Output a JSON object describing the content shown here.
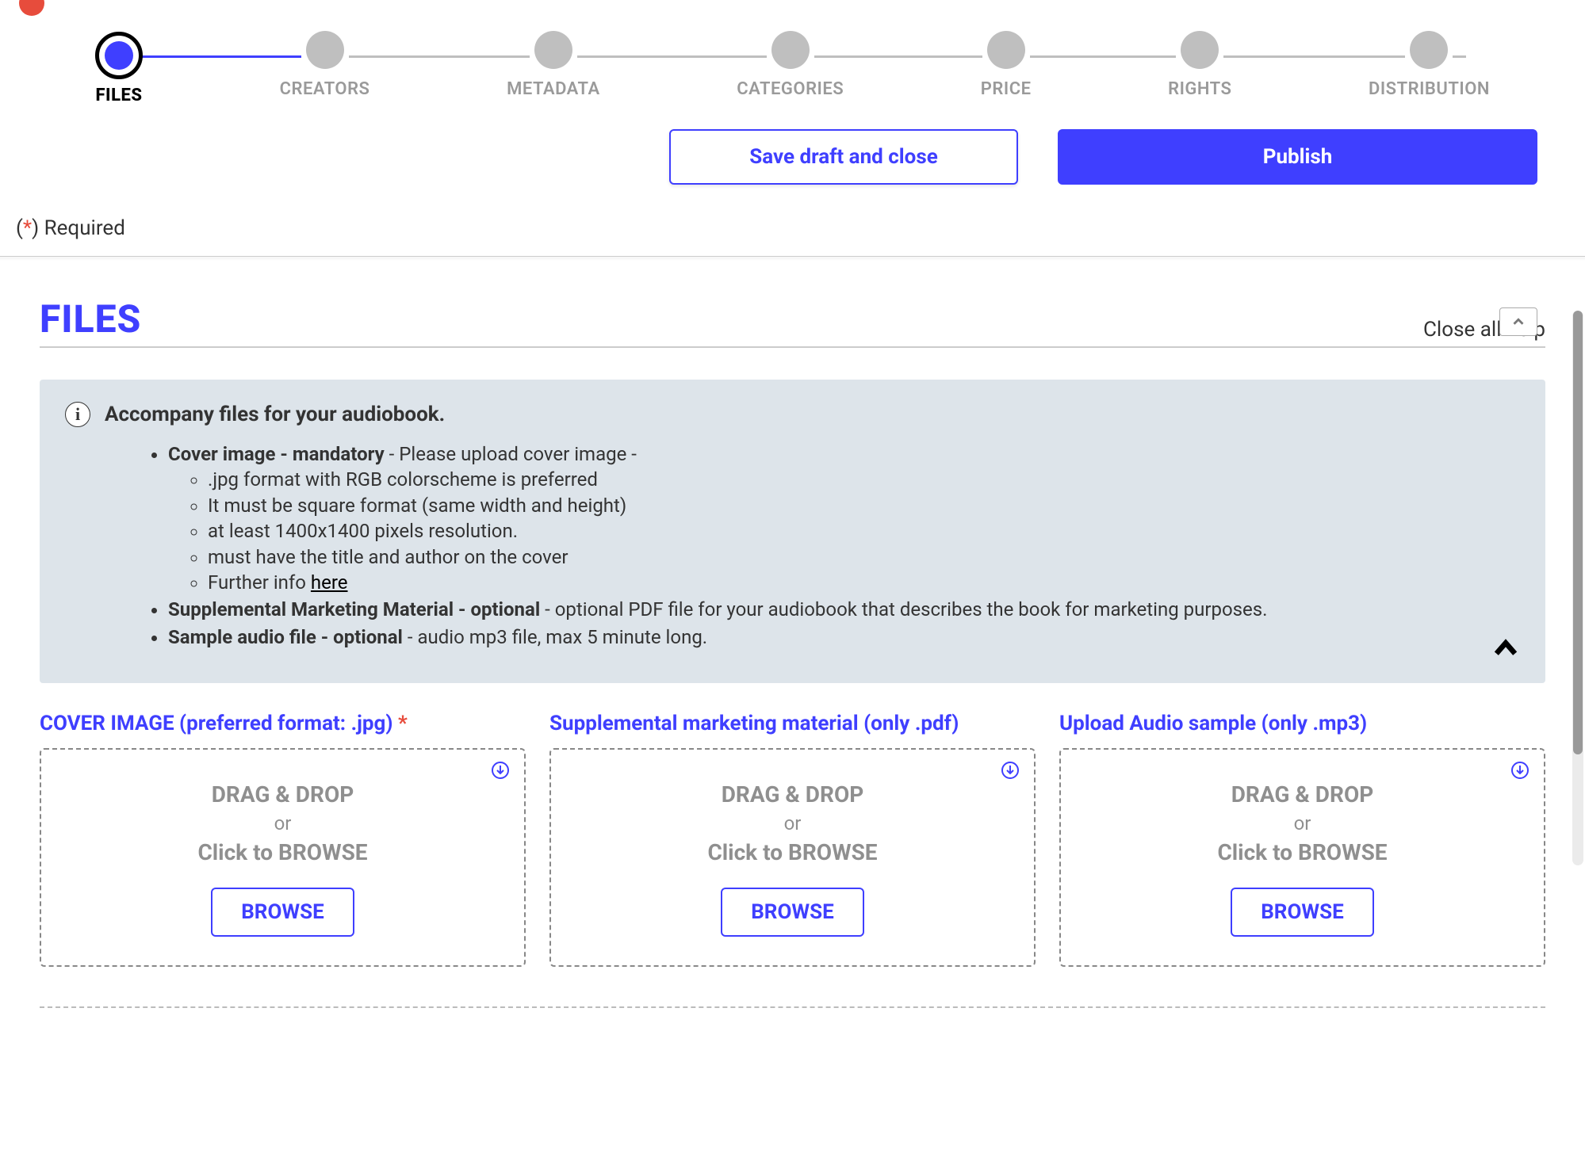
{
  "stepper": {
    "steps": [
      {
        "label": "FILES",
        "active": true
      },
      {
        "label": "CREATORS"
      },
      {
        "label": "METADATA"
      },
      {
        "label": "CATEGORIES"
      },
      {
        "label": "PRICE"
      },
      {
        "label": "RIGHTS"
      },
      {
        "label": "DISTRIBUTION"
      }
    ]
  },
  "actions": {
    "save_draft": "Save draft and close",
    "publish": "Publish"
  },
  "required_note": {
    "prefix": "(",
    "star": "*",
    "suffix": ") Required"
  },
  "section": {
    "title": "FILES",
    "close_help": "Close all help"
  },
  "info": {
    "title": "Accompany files for your audiobook.",
    "cover": {
      "bold": "Cover image - mandatory",
      "rest": " - Please upload cover image -",
      "details": [
        ".jpg format with RGB colorscheme is preferred",
        "It must be square format (same width and height)",
        "at least 1400x1400 pixels resolution.",
        "must have the title and author on the cover"
      ],
      "further_prefix": "Further info ",
      "further_link": "here"
    },
    "supplemental": {
      "bold": "Supplemental Marketing Material - optional",
      "rest": " - optional PDF file for your audiobook that describes the book for marketing purposes."
    },
    "sample": {
      "bold": "Sample audio file - optional",
      "rest": " - audio mp3 file, max 5 minute long."
    }
  },
  "uploads": {
    "drag": "DRAG & DROP",
    "or": "or",
    "click": "Click to BROWSE",
    "browse": "BROWSE",
    "cols": [
      {
        "label": "COVER IMAGE (preferred format: .jpg)",
        "required": true
      },
      {
        "label": "Supplemental marketing material (only .pdf)",
        "required": false
      },
      {
        "label": "Upload Audio sample (only .mp3)",
        "required": false
      }
    ]
  }
}
